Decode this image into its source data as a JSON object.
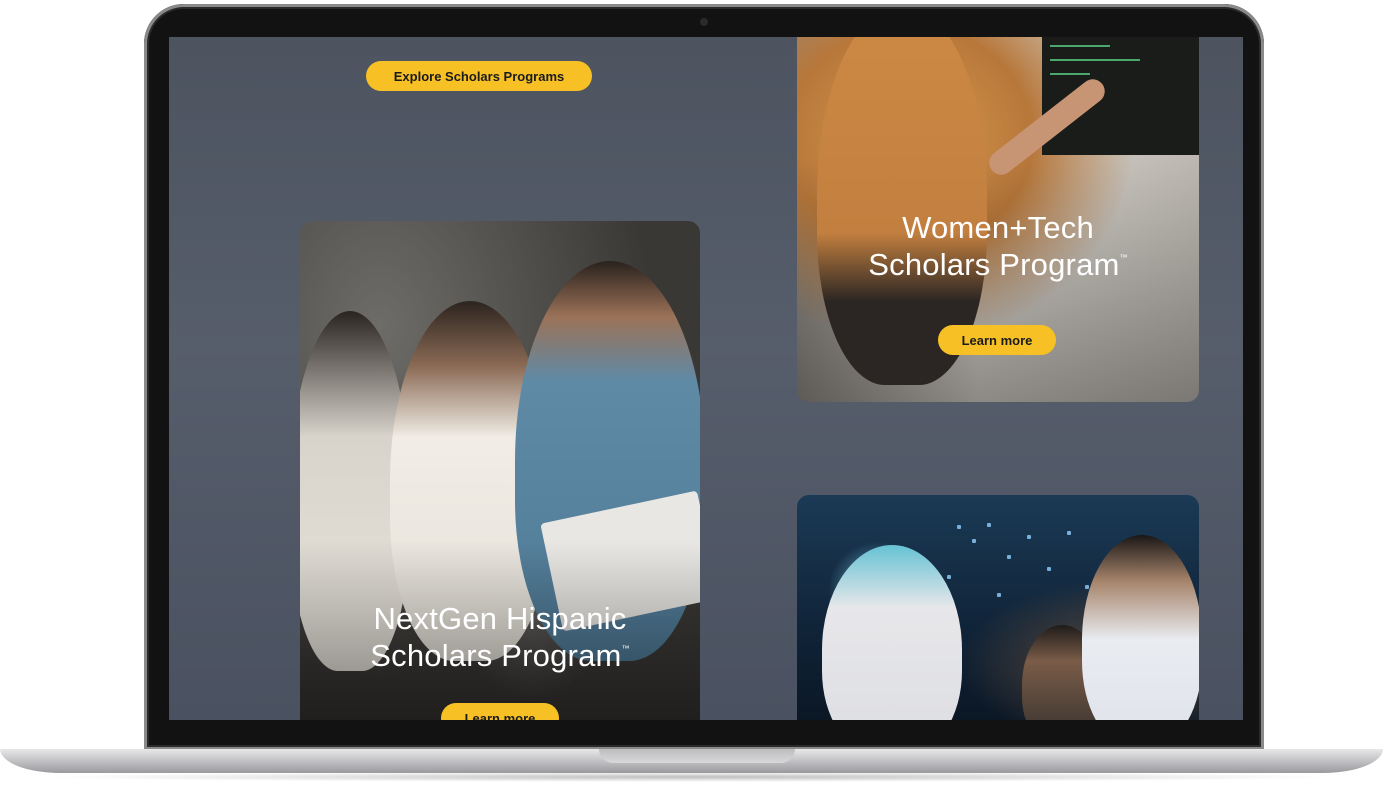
{
  "screen": {
    "explore_button": "Explore Scholars Programs",
    "cards": [
      {
        "title_line1": "NextGen Hispanic",
        "title_line2": "Scholars Program",
        "trademark": "™",
        "button": "Learn more"
      },
      {
        "title_line1": "Women+Tech",
        "title_line2": "Scholars Program",
        "trademark": "™",
        "button": "Learn more"
      }
    ]
  },
  "colors": {
    "accent": "#f7c025",
    "background": "#535a67",
    "title_text": "#ffffff"
  }
}
